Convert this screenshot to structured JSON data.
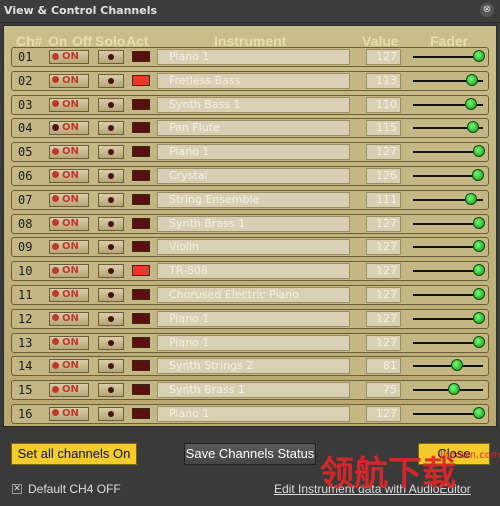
{
  "window": {
    "title": "View & Control Channels",
    "close_glyph": "⊗"
  },
  "headers": {
    "ch": "Ch#",
    "on": "On",
    "off": "Off",
    "solo": "Solo",
    "act": "Act",
    "instrument": "Instrument",
    "value": "Value",
    "fader": "Fader"
  },
  "channels": [
    {
      "num": "01",
      "on_label": "ON",
      "instrument": "Piano 1",
      "value": "127",
      "fader_level": 1.0,
      "active": false
    },
    {
      "num": "02",
      "on_label": "ON",
      "instrument": "Fretless Bass",
      "value": "113",
      "fader_level": 0.89,
      "active": true
    },
    {
      "num": "03",
      "on_label": "ON",
      "instrument": "Synth Bass 1",
      "value": "110",
      "fader_level": 0.87,
      "active": false
    },
    {
      "num": "04",
      "on_label": "ON",
      "instrument": "Pan Flute",
      "value": "115",
      "fader_level": 0.91,
      "active": false
    },
    {
      "num": "05",
      "on_label": "ON",
      "instrument": "Piano 1",
      "value": "127",
      "fader_level": 1.0,
      "active": false
    },
    {
      "num": "06",
      "on_label": "ON",
      "instrument": "Crystal",
      "value": "126",
      "fader_level": 0.99,
      "active": false
    },
    {
      "num": "07",
      "on_label": "ON",
      "instrument": "String Ensemble",
      "value": "111",
      "fader_level": 0.87,
      "active": false
    },
    {
      "num": "08",
      "on_label": "ON",
      "instrument": "Synth Brass 1",
      "value": "127",
      "fader_level": 1.0,
      "active": false
    },
    {
      "num": "09",
      "on_label": "ON",
      "instrument": "Violin",
      "value": "127",
      "fader_level": 1.0,
      "active": false
    },
    {
      "num": "10",
      "on_label": "ON",
      "instrument": "TR-808",
      "value": "127",
      "fader_level": 1.0,
      "active": true
    },
    {
      "num": "11",
      "on_label": "ON",
      "instrument": "Chorused Electric Piano",
      "value": "127",
      "fader_level": 1.0,
      "active": false
    },
    {
      "num": "12",
      "on_label": "ON",
      "instrument": "Piano 1",
      "value": "127",
      "fader_level": 1.0,
      "active": false
    },
    {
      "num": "13",
      "on_label": "ON",
      "instrument": "Piano 1",
      "value": "127",
      "fader_level": 1.0,
      "active": false
    },
    {
      "num": "14",
      "on_label": "ON",
      "instrument": "Synth Strings 2",
      "value": "81",
      "fader_level": 0.64,
      "active": false
    },
    {
      "num": "15",
      "on_label": "ON",
      "instrument": "Synth Brass 1",
      "value": "75",
      "fader_level": 0.59,
      "active": false
    },
    {
      "num": "16",
      "on_label": "ON",
      "instrument": "Piano 1",
      "value": "127",
      "fader_level": 1.0,
      "active": false
    }
  ],
  "buttons": {
    "set_all_on": "Set all channels On",
    "save_status": "Save Channels Status",
    "close": "Close"
  },
  "default_ch4": {
    "label": "Default CH4 OFF",
    "checked": true,
    "check_glyph": "✕"
  },
  "edit_link": "Edit Instrument data with AudioEditor",
  "watermark": {
    "text": "领航下载",
    "site": "lhdown.com"
  },
  "colors": {
    "act_on": "#e8392b",
    "act_off": "#5a1010",
    "accent_yellow": "#f4cc2a"
  }
}
